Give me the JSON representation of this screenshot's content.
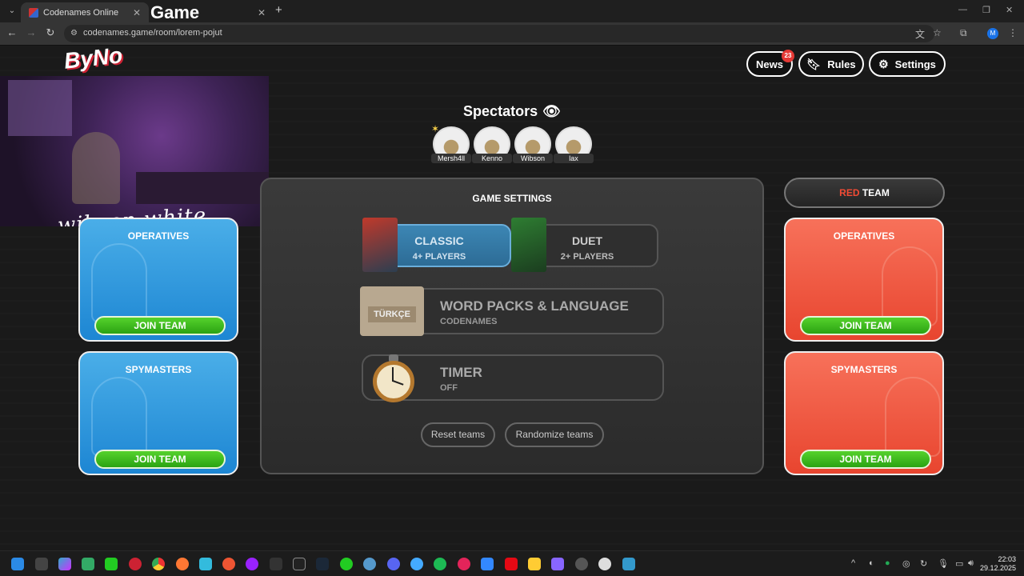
{
  "browser": {
    "tabs": [
      {
        "title": "Codenames Online",
        "close": "✕"
      },
      {
        "title": "",
        "close": "✕"
      }
    ],
    "new_tab": "+",
    "url": "codenames.game/room/lorem-pojut"
  },
  "overlay": {
    "logo_text": "ByNo",
    "logo_word": "Game",
    "signature": "wibson white"
  },
  "header": {
    "news_label": "News",
    "news_badge": "23",
    "rules_label": "Rules",
    "settings_label": "Settings"
  },
  "spectators": {
    "title": "Spectators",
    "people": [
      "Mersh4ll",
      "Kenno",
      "Wibson",
      "lax"
    ]
  },
  "blue_team": {
    "operatives_title": "OPERATIVES",
    "operatives_join": "JOIN TEAM",
    "spymasters_title": "SPYMASTERS",
    "spymasters_join": "JOIN TEAM"
  },
  "red_team": {
    "header_red": "RED",
    "header_team": "TEAM",
    "operatives_title": "OPERATIVES",
    "operatives_join": "JOIN TEAM",
    "spymasters_title": "SPYMASTERS",
    "spymasters_join": "JOIN TEAM"
  },
  "game_settings": {
    "title": "GAME SETTINGS",
    "modes": [
      {
        "name": "CLASSIC",
        "players": "4+ PLAYERS",
        "active": true
      },
      {
        "name": "DUET",
        "players": "2+ PLAYERS",
        "active": false
      }
    ],
    "word_packs": {
      "name": "WORD PACKS & LANGUAGE",
      "value": "CODENAMES",
      "pack_label": "TÜRKÇE"
    },
    "timer": {
      "name": "TIMER",
      "value": "OFF"
    },
    "reset_label": "Reset teams",
    "randomize_label": "Randomize teams"
  },
  "taskbar": {
    "time": "22:03",
    "date": "29.12.2025"
  },
  "colors": {
    "blue_team": "#2a95dc",
    "red_team": "#ee5a40",
    "join_green": "#3cbc1e",
    "classic_active": "#3479a6"
  }
}
